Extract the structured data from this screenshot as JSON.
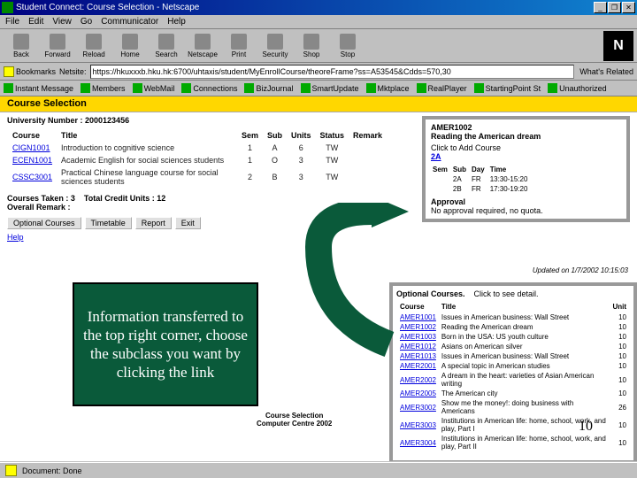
{
  "window": {
    "title": "Student Connect: Course Selection - Netscape",
    "min": "_",
    "max": "❐",
    "close": "✕"
  },
  "menu": [
    "File",
    "Edit",
    "View",
    "Go",
    "Communicator",
    "Help"
  ],
  "toolbar": {
    "items": [
      "Back",
      "Forward",
      "Reload",
      "Home",
      "Search",
      "Netscape",
      "Print",
      "Security",
      "Shop",
      "Stop"
    ],
    "logo": "N"
  },
  "location": {
    "bookmarks": "Bookmarks",
    "label": "Netsite:",
    "url": "https://hkuxxxb.hku.hk:6700/uhtaxis/student/MyEnrollCourse/theoreFrame?ss=A53545&Cdds=570,30",
    "whats": "What's Related"
  },
  "links": [
    "Instant Message",
    "Members",
    "WebMail",
    "Connections",
    "BizJournal",
    "SmartUpdate",
    "Mktplace",
    "RealPlayer",
    "StartingPoint St",
    "Unauthorized"
  ],
  "page": {
    "heading": "Course Selection",
    "univno": "University Number : 2000123456",
    "table": {
      "headers": [
        "Course",
        "Title",
        "Sem",
        "Sub",
        "Units",
        "Status",
        "Remark"
      ],
      "rows": [
        {
          "code": "CIGN1001",
          "title": "Introduction to cognitive science",
          "sem": "1",
          "sub": "A",
          "units": "6",
          "status": "TW",
          "remark": ""
        },
        {
          "code": "ECEN1001",
          "title": "Academic English for social sciences students",
          "sem": "1",
          "sub": "O",
          "units": "3",
          "status": "TW",
          "remark": ""
        },
        {
          "code": "CSSC3001",
          "title": "Practical Chinese language course for social sciences students",
          "sem": "2",
          "sub": "B",
          "units": "3",
          "status": "TW",
          "remark": ""
        }
      ]
    },
    "summary": {
      "taken": "Courses Taken : 3",
      "units": "Total Credit Units : 12",
      "overall": "Overall Remark :"
    },
    "buttons": [
      "Optional Courses",
      "Timetable",
      "Report",
      "Exit"
    ],
    "help": "Help"
  },
  "detail": {
    "code": "AMER1002",
    "title": "Reading the American dream",
    "add": "Click to Add Course",
    "sub": "2A",
    "schedHdr": [
      "Sem",
      "Sub",
      "Day",
      "Time"
    ],
    "sched": [
      {
        "sem": "",
        "sub": "2A",
        "day": "FR",
        "time": "13:30-15:20"
      },
      {
        "sem": "",
        "sub": "2B",
        "day": "FR",
        "time": "17:30-19:20"
      }
    ],
    "approval": "Approval",
    "noapproval": "No approval required, no quota."
  },
  "updated": "Updated on 1/7/2002 10:15:03",
  "optional": {
    "title": "Optional Courses.",
    "hint": "Click to see detail.",
    "headers": [
      "Course",
      "Title",
      "Unit"
    ],
    "rows": [
      {
        "code": "AMER1001",
        "title": "Issues in American business: Wall Street",
        "unit": "10"
      },
      {
        "code": "AMER1002",
        "title": "Reading the American dream",
        "unit": "10"
      },
      {
        "code": "AMER1003",
        "title": "Born in the USA: US youth culture",
        "unit": "10"
      },
      {
        "code": "AMER1012",
        "title": "Asians on American silver",
        "unit": "10"
      },
      {
        "code": "AMER1013",
        "title": "Issues in American business: Wall Street",
        "unit": "10"
      },
      {
        "code": "AMER2001",
        "title": "A special topic in American studies",
        "unit": "10"
      },
      {
        "code": "AMER2002",
        "title": "A dream in the heart: varieties of Asian American writing",
        "unit": "10"
      },
      {
        "code": "AMER2005",
        "title": "The American city",
        "unit": "10"
      },
      {
        "code": "AMER3002",
        "title": "Show me the money!: doing business with Americans",
        "unit": "26"
      },
      {
        "code": "AMER3003",
        "title": "Institutions in American life: home, school, work, and play, Part I",
        "unit": "10"
      },
      {
        "code": "AMER3004",
        "title": "Institutions in American life: home, school, work, and play, Part II",
        "unit": "10"
      }
    ]
  },
  "callout": "Information transferred to the top right corner, choose the subclass you want by clicking the link",
  "footer": {
    "l1": "Course Selection",
    "l2": "Computer Centre 2002"
  },
  "slidenum": "10",
  "status": "Document: Done"
}
